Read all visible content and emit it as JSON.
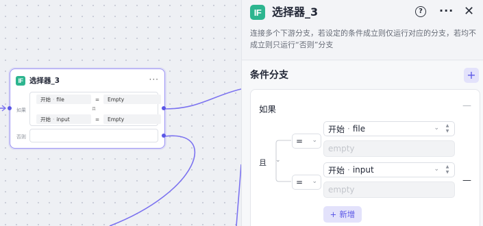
{
  "node": {
    "badge": "IF",
    "title": "选择器_3",
    "more": "···",
    "if_label": "如果",
    "else_label": "否则",
    "logic": "且",
    "conditions": [
      {
        "var_node": "开始",
        "var_sep": "·",
        "var_name": "file",
        "operator": "=",
        "value": "Empty"
      },
      {
        "var_node": "开始",
        "var_sep": "·",
        "var_name": "input",
        "operator": "=",
        "value": "Empty"
      }
    ]
  },
  "panel": {
    "badge": "IF",
    "title": "选择器_3",
    "help_icon": "?",
    "more_icon": "···",
    "close_icon": "✕",
    "description": "连接多个下游分支，若设定的条件成立则仅运行对应的分支，若均不成立则只运行“否则”分支",
    "section_title": "条件分支",
    "add_case_icon": "+",
    "case": {
      "label": "如果",
      "collapse_icon": "—",
      "logic": "且",
      "logic_chevron": "⌄",
      "conditions": [
        {
          "operator": "=",
          "var_node": "开始",
          "var_sep": "·",
          "var_name": "file",
          "value_placeholder": "empty"
        },
        {
          "operator": "=",
          "var_node": "开始",
          "var_sep": "·",
          "var_name": "input",
          "value_placeholder": "empty"
        }
      ],
      "remove_icon": "—",
      "add_condition": {
        "icon": "+",
        "label": "新增"
      }
    }
  },
  "colors": {
    "accent": "#5b57e6",
    "if_badge": "#2db58f",
    "node_border": "#9c93f5",
    "edge": "#7b72f0"
  }
}
